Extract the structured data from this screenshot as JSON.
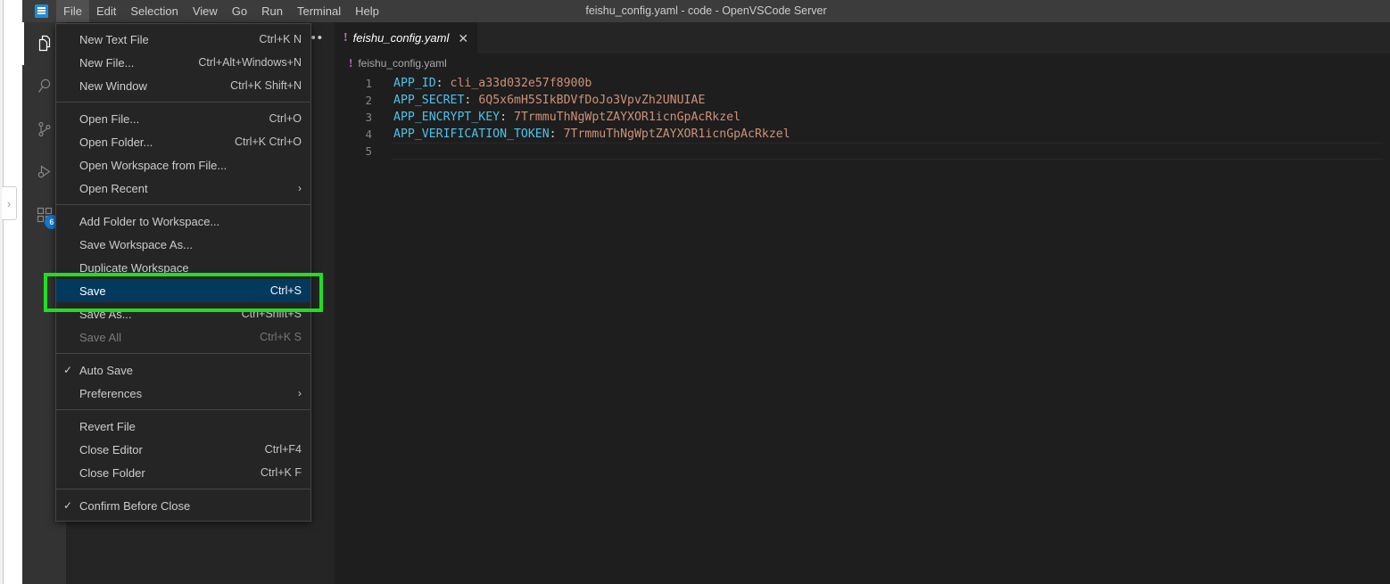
{
  "window": {
    "title": "feishu_config.yaml - code - OpenVSCode Server",
    "logo_icon": "vscode-logo-icon"
  },
  "menubar": {
    "items": [
      {
        "label": "File",
        "active": true
      },
      {
        "label": "Edit",
        "active": false
      },
      {
        "label": "Selection",
        "active": false
      },
      {
        "label": "View",
        "active": false
      },
      {
        "label": "Go",
        "active": false
      },
      {
        "label": "Run",
        "active": false
      },
      {
        "label": "Terminal",
        "active": false
      },
      {
        "label": "Help",
        "active": false
      }
    ]
  },
  "activitybar": {
    "items": [
      {
        "name": "explorer",
        "icon": "files-icon",
        "active": true,
        "badge": ""
      },
      {
        "name": "search",
        "icon": "search-icon",
        "active": false,
        "badge": ""
      },
      {
        "name": "source-control",
        "icon": "source-control-icon",
        "active": false,
        "badge": ""
      },
      {
        "name": "run-and-debug",
        "icon": "run-debug-icon",
        "active": false,
        "badge": ""
      },
      {
        "name": "extensions",
        "icon": "extensions-icon",
        "active": false,
        "badge": "6"
      }
    ]
  },
  "sidebar": {
    "actions_glyph": "••"
  },
  "left_gutter": {
    "expand_handle_glyph": "›"
  },
  "editor": {
    "tab": {
      "warning_glyph": "!",
      "label": "feishu_config.yaml",
      "close_glyph": "✕"
    },
    "breadcrumb": {
      "icon_glyph": "!",
      "label": "feishu_config.yaml"
    },
    "lines": [
      {
        "number": "1",
        "key": "APP_ID",
        "colon": ":",
        "value": "cli_a33d032e57f8900b",
        "current": false
      },
      {
        "number": "2",
        "key": "APP_SECRET",
        "colon": ":",
        "value": "6Q5x6mH5SIkBDVfDoJo3VpvZh2UNUIAE",
        "current": false
      },
      {
        "number": "3",
        "key": "APP_ENCRYPT_KEY",
        "colon": ":",
        "value": "7TrmmuThNgWptZAYXOR1icnGpAcRkzel",
        "current": false
      },
      {
        "number": "4",
        "key": "APP_VERIFICATION_TOKEN",
        "colon": ":",
        "value": "7TrmmuThNgWptZAYXOR1icnGpAcRkzel",
        "current": false
      },
      {
        "number": "5",
        "key": "",
        "colon": "",
        "value": "",
        "current": true
      }
    ]
  },
  "file_menu": {
    "groups": [
      {
        "items": [
          {
            "check": "",
            "label": "New Text File",
            "key": "Ctrl+K N",
            "submenu": "",
            "state": "normal"
          },
          {
            "check": "",
            "label": "New File...",
            "key": "Ctrl+Alt+Windows+N",
            "submenu": "",
            "state": "normal"
          },
          {
            "check": "",
            "label": "New Window",
            "key": "Ctrl+K Shift+N",
            "submenu": "",
            "state": "normal"
          }
        ]
      },
      {
        "items": [
          {
            "check": "",
            "label": "Open File...",
            "key": "Ctrl+O",
            "submenu": "",
            "state": "normal"
          },
          {
            "check": "",
            "label": "Open Folder...",
            "key": "Ctrl+K Ctrl+O",
            "submenu": "",
            "state": "normal"
          },
          {
            "check": "",
            "label": "Open Workspace from File...",
            "key": "",
            "submenu": "",
            "state": "normal"
          },
          {
            "check": "",
            "label": "Open Recent",
            "key": "",
            "submenu": "›",
            "state": "normal"
          }
        ]
      },
      {
        "items": [
          {
            "check": "",
            "label": "Add Folder to Workspace...",
            "key": "",
            "submenu": "",
            "state": "normal"
          },
          {
            "check": "",
            "label": "Save Workspace As...",
            "key": "",
            "submenu": "",
            "state": "normal"
          },
          {
            "check": "",
            "label": "Duplicate Workspace",
            "key": "",
            "submenu": "",
            "state": "normal"
          },
          {
            "check": "",
            "label": "Save",
            "key": "Ctrl+S",
            "submenu": "",
            "state": "selected"
          },
          {
            "check": "",
            "label": "Save As...",
            "key": "Ctrl+Shift+S",
            "submenu": "",
            "state": "normal"
          },
          {
            "check": "",
            "label": "Save All",
            "key": "Ctrl+K S",
            "submenu": "",
            "state": "disabled"
          }
        ]
      },
      {
        "items": [
          {
            "check": "✓",
            "label": "Auto Save",
            "key": "",
            "submenu": "",
            "state": "normal"
          },
          {
            "check": "",
            "label": "Preferences",
            "key": "",
            "submenu": "›",
            "state": "normal"
          }
        ]
      },
      {
        "items": [
          {
            "check": "",
            "label": "Revert File",
            "key": "",
            "submenu": "",
            "state": "normal"
          },
          {
            "check": "",
            "label": "Close Editor",
            "key": "Ctrl+F4",
            "submenu": "",
            "state": "normal"
          },
          {
            "check": "",
            "label": "Close Folder",
            "key": "Ctrl+K F",
            "submenu": "",
            "state": "normal"
          }
        ]
      },
      {
        "items": [
          {
            "check": "✓",
            "label": "Confirm Before Close",
            "key": "",
            "submenu": "",
            "state": "normal"
          }
        ]
      }
    ]
  },
  "annotation": {
    "color": "#22dd22",
    "target": "Save"
  },
  "colors": {
    "titlebar_bg": "#3c3c3c",
    "activitybar_bg": "#333333",
    "sidebar_bg": "#252526",
    "editor_bg": "#1e1e1e",
    "menu_bg": "#252526",
    "menu_selected_bg": "#04395e",
    "badge_bg": "#0d7ad6",
    "yaml_key": "#4fc1e9",
    "yaml_value": "#ce9178",
    "annotation_green": "#22dd22"
  }
}
